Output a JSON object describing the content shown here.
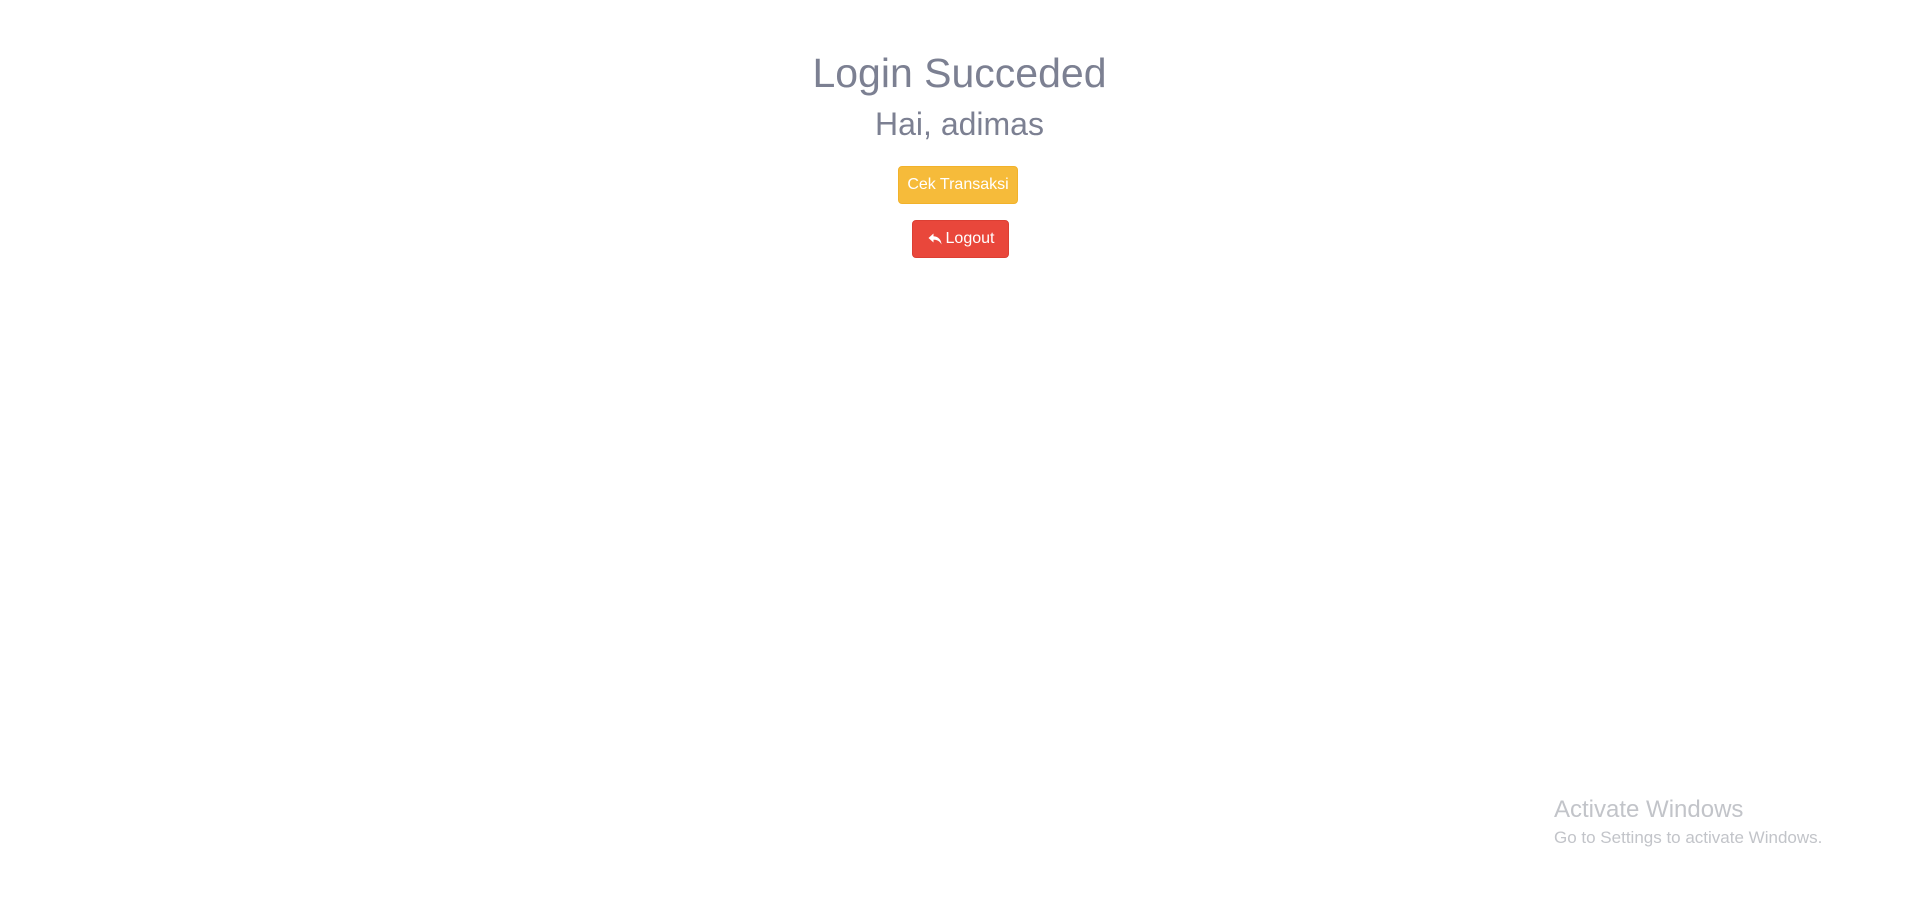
{
  "main": {
    "title": "Login Succeded",
    "greeting": "Hai, adimas",
    "buttons": {
      "check_transaction_label": "Cek Transaksi",
      "logout_label": "Logout",
      "logout_icon": "reply-arrow-icon"
    }
  },
  "watermark": {
    "title": "Activate Windows",
    "subtitle": "Go to Settings to activate Windows."
  },
  "colors": {
    "text_muted": "#7c8092",
    "warning": "#f6bb3a",
    "danger": "#e9473b",
    "watermark": "#c2c4c9"
  }
}
